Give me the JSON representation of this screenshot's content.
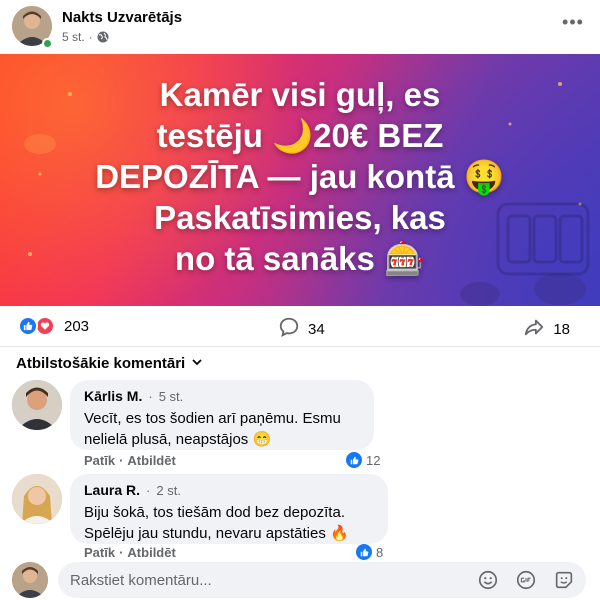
{
  "post": {
    "author": "Nakts Uzvarētājs",
    "time": "5 st.",
    "separator": "·",
    "more_label": "•••"
  },
  "banner": {
    "lines": [
      "Kamēr visi guļ, es",
      "testēju 🌙20€ BEZ",
      "DEPOZĪTA — jau kontā 🤑",
      "Paskatīsimies, kas",
      "no tā sanāks 🎰"
    ]
  },
  "stats": {
    "reactions": "203",
    "comments": "34",
    "shares": "18"
  },
  "comments_filter": "Atbilstošākie komentāri",
  "comments": [
    {
      "author": "Kārlis M.",
      "time": "5 st.",
      "lines": [
        "Vecīt, es tos šodien arī paņēmu. Esmu",
        "nelielā plusā, neapstājos 😁"
      ],
      "like_action": "Patīk",
      "reply_action": "Atbildēt",
      "likes": "12"
    },
    {
      "author": "Laura R.",
      "time": "2 st.",
      "lines": [
        "Biju šokā, tos tiešām dod bez depozīta.",
        "Spēlēju jau stundu, nevaru apstāties 🔥"
      ],
      "like_action": "Patīk",
      "reply_action": "Atbildēt",
      "likes": "8"
    }
  ],
  "composer": {
    "placeholder": "Rakstiet komentāru..."
  },
  "colors": {
    "like_blue": "#1877f2",
    "love_red": "#f33e58",
    "online_green": "#31a24c",
    "bubble_bg": "#f0f2f5"
  }
}
